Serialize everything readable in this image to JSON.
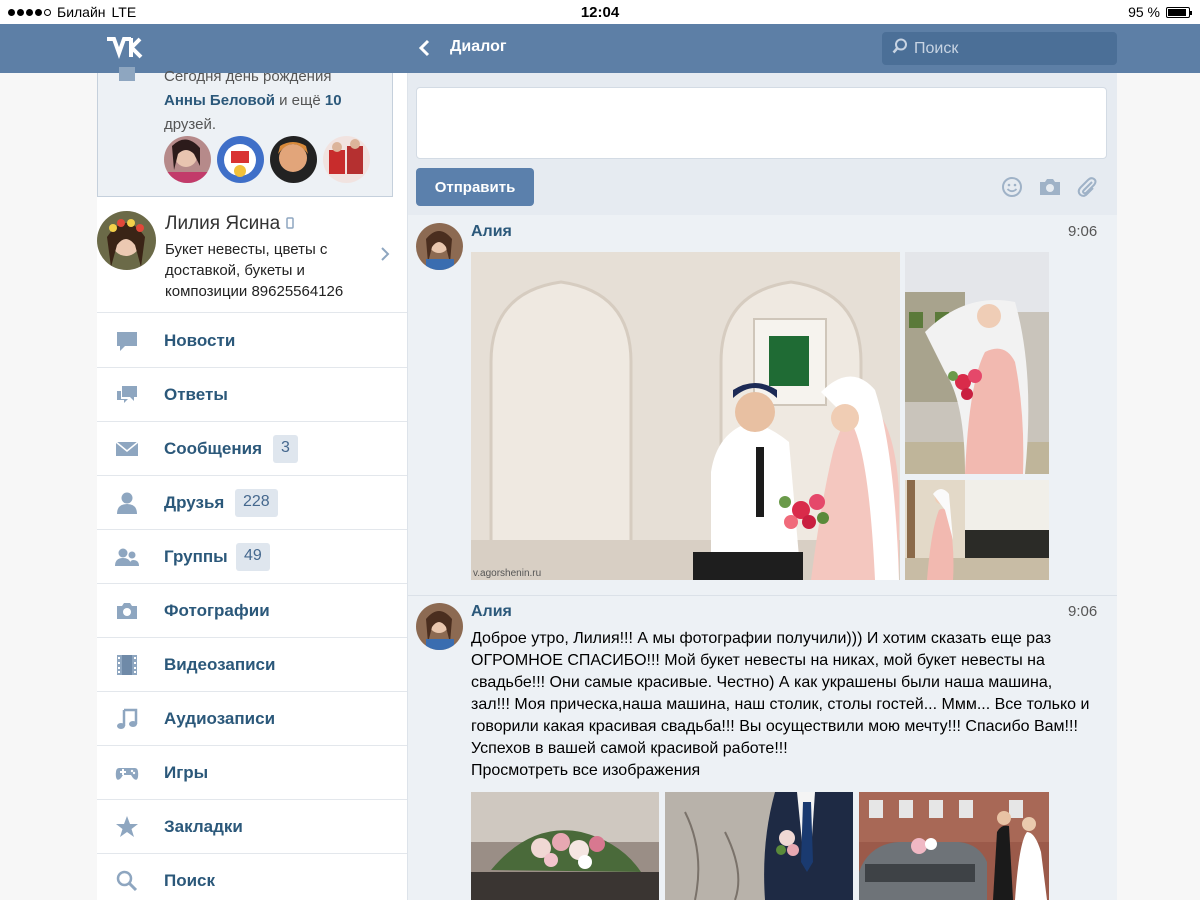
{
  "status_bar": {
    "carrier": "Билайн",
    "network": "LTE",
    "time": "12:04",
    "battery": "95 %"
  },
  "header": {
    "logo": "vk-logo",
    "title": "Диалог",
    "search_placeholder": "Поиск"
  },
  "sidebar": {
    "birthday": {
      "line1": "Сегодня день рождения",
      "name": "Анны Беловой",
      "mid": " и ещё ",
      "count": "10",
      "tail": "друзей."
    },
    "profile": {
      "name": "Лилия Ясина",
      "status": "Букет невесты, цветы с доставкой, букеты и композиции 89625564126"
    },
    "menu": [
      {
        "label": "Новости",
        "icon": "news-icon"
      },
      {
        "label": "Ответы",
        "icon": "replies-icon"
      },
      {
        "label": "Сообщения",
        "icon": "messages-icon",
        "badge": "3"
      },
      {
        "label": "Друзья",
        "icon": "friends-icon",
        "badge": "228"
      },
      {
        "label": "Группы",
        "icon": "groups-icon",
        "badge": "49"
      },
      {
        "label": "Фотографии",
        "icon": "camera-icon"
      },
      {
        "label": "Видеозаписи",
        "icon": "video-icon"
      },
      {
        "label": "Аудиозаписи",
        "icon": "music-icon"
      },
      {
        "label": "Игры",
        "icon": "gamepad-icon"
      },
      {
        "label": "Закладки",
        "icon": "star-icon"
      },
      {
        "label": "Поиск",
        "icon": "search-icon"
      }
    ]
  },
  "composer": {
    "send_label": "Отправить"
  },
  "messages": [
    {
      "author": "Алия",
      "time": "9:06",
      "watermark": "v.agorshenin.ru"
    },
    {
      "author": "Алия",
      "time": "9:06",
      "text": "Доброе утро, Лилия!!! А мы фотографии получили))) И хотим сказать еще раз ОГРОМНОЕ СПАСИБО!!! Мой букет невесты на никах, мой букет невесты на свадьбе!!! Они самые красивые. Честно) А как украшены были наша машина, зал!!! Моя прическа,наша машина, наш столик, столы гостей... Ммм... Все только и говорили какая красивая свадьба!!! Вы осуществили мою мечту!!! Спасибо Вам!!! Успехов в вашей самой красивой работе!!!",
      "link": "Просмотреть все изображения"
    }
  ]
}
